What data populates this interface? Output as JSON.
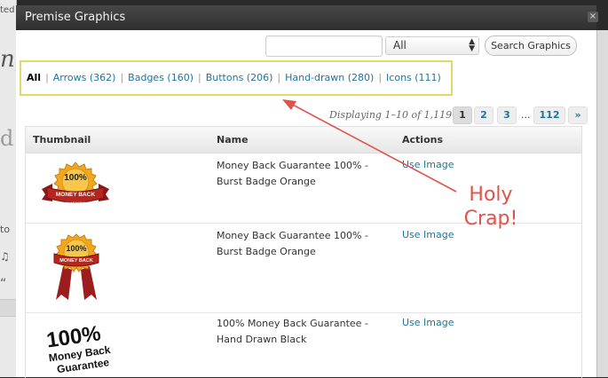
{
  "modal": {
    "title": "Premise Graphics",
    "close_glyph": "×"
  },
  "search": {
    "placeholder": "",
    "type_value": "All",
    "button_label": "Search Graphics"
  },
  "filters": [
    {
      "label": "All",
      "current": true
    },
    {
      "label": "Arrows (362)"
    },
    {
      "label": "Badges (160)"
    },
    {
      "label": "Buttons (206)"
    },
    {
      "label": "Hand-drawn (280)"
    },
    {
      "label": "Icons (111)"
    }
  ],
  "pagination": {
    "displaying": "Displaying 1–10 of 1,119",
    "pages": [
      "1",
      "2",
      "3"
    ],
    "ellipsis": "...",
    "last": "112",
    "next": "»"
  },
  "table": {
    "headers": [
      "Thumbnail",
      "Name",
      "Actions"
    ],
    "rows": [
      {
        "name": "Money Back Guarantee 100% - Burst Badge Orange",
        "action": "Use Image",
        "thumb": "badge-ribbon-icon"
      },
      {
        "name": "Money Back Guarantee 100% - Burst Badge Orange",
        "action": "Use Image",
        "thumb": "badge-hanging-ribbon-icon"
      },
      {
        "name": "100% Money Back Guarantee - Hand Drawn Black",
        "action": "Use Image",
        "thumb": "hand-drawn-stamp-icon"
      }
    ]
  },
  "thumbs": {
    "badge_big": "100%",
    "badge_small": "MONEY BACK",
    "badge_tiny": "GUARANTEE",
    "hand_big": "100%",
    "hand_mid": "Money Back",
    "hand_small": "Guarantee"
  },
  "annotation": {
    "text": "Holy Crap!",
    "color": "#e0524a"
  },
  "background_fragments": [
    "ted",
    "ng",
    "d",
    "to",
    "♫",
    "“"
  ],
  "colors": {
    "link": "#21759b",
    "highlight": "#e3d76c",
    "titlebar": "#3a3a3a"
  }
}
